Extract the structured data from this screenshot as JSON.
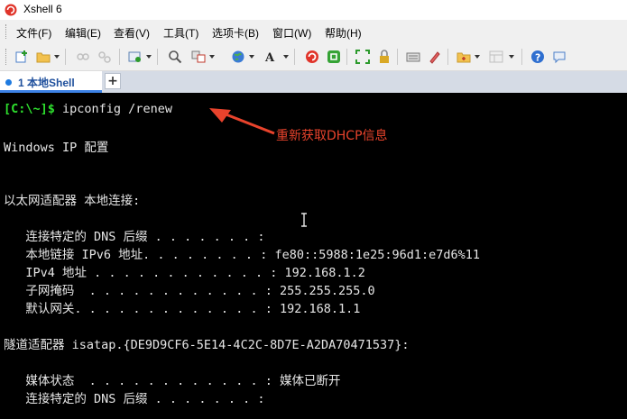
{
  "window": {
    "title": "Xshell 6"
  },
  "menu": [
    "文件(F)",
    "编辑(E)",
    "查看(V)",
    "工具(T)",
    "选项卡(B)",
    "窗口(W)",
    "帮助(H)"
  ],
  "tabs": [
    {
      "label": "1 本地Shell"
    }
  ],
  "tab_add_label": "+",
  "terminal": {
    "prompt": "[C:\\~]$",
    "command": " ipconfig /renew",
    "lines": [
      "Windows IP 配置",
      "以太网适配器 本地连接:",
      "   连接特定的 DNS 后缀 . . . . . . . :",
      "   本地链接 IPv6 地址. . . . . . . . : fe80::5988:1e25:96d1:e7d6%11",
      "   IPv4 地址 . . . . . . . . . . . . : 192.168.1.2",
      "   子网掩码  . . . . . . . . . . . . : 255.255.255.0",
      "   默认网关. . . . . . . . . . . . . : 192.168.1.1",
      "隧道适配器 isatap.{DE9D9CF6-5E14-4C2C-8D7E-A2DA70471537}:",
      "   媒体状态  . . . . . . . . . . . . : 媒体已断开",
      "   连接特定的 DNS 后缀 . . . . . . . :"
    ]
  },
  "annotation": {
    "text": "重新获取DHCP信息",
    "color": "#e8432c"
  },
  "colors": {
    "prompt": "#2ee02e",
    "terminal_bg": "#000000",
    "tab_accent": "#3c82e6"
  }
}
